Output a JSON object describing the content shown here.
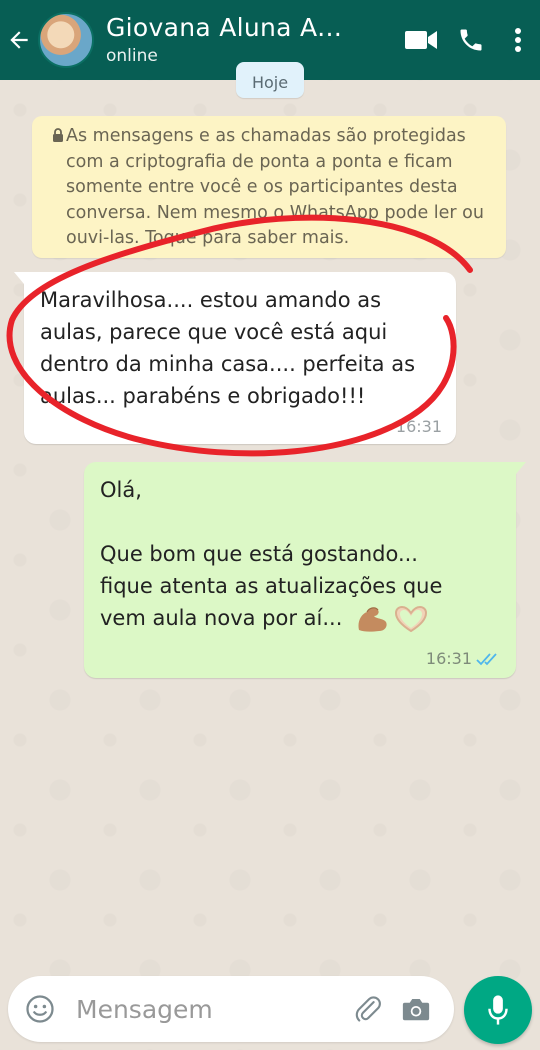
{
  "header": {
    "contact_name": "Giovana Aluna AC...",
    "status": "online"
  },
  "date_chip": "Hoje",
  "encryption_notice": "As mensagens e as chamadas são protegidas com a criptografia de ponta a ponta e ficam somente entre você e os participantes desta conversa. Nem mesmo o WhatsApp pode ler ou ouvi-las. Toque para saber mais.",
  "messages": [
    {
      "direction": "incoming",
      "text": "Maravilhosa.... estou amando as aulas, parece que você está aqui dentro da minha casa.... perfeita as aulas... parabéns e obrigado!!!",
      "time": "16:31"
    },
    {
      "direction": "outgoing",
      "line1": "Olá,",
      "line2": "Que bom que está gostando...",
      "line3": "fique atenta as atualizações que",
      "line4": "vem aula nova por aí...",
      "time": "16:31",
      "status_icon": "double-check-read-icon"
    }
  ],
  "composer": {
    "placeholder": "Mensagem"
  },
  "colors": {
    "header": "#075e54",
    "incoming_bubble": "#ffffff",
    "outgoing_bubble": "#dcf8c6",
    "notice_bg": "#fdf4c5",
    "mic_button": "#00a884",
    "annotation_circle": "#e8232a",
    "read_check": "#4fb6ec"
  }
}
